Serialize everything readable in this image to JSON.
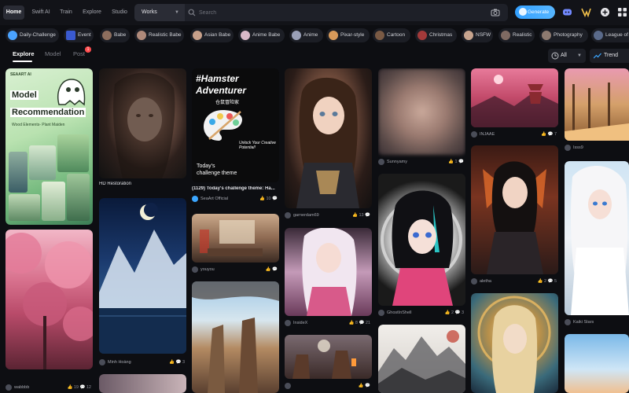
{
  "nav": {
    "tabs": [
      "Home",
      "Swift AI",
      "Train",
      "Explore",
      "Studio"
    ],
    "active_tab": "Home"
  },
  "search": {
    "scope": "Works",
    "placeholder": "Search"
  },
  "header": {
    "generate_label": "Generate",
    "icons": [
      "discord-icon",
      "vip-icon",
      "add-icon",
      "apps-grid-icon"
    ]
  },
  "categories": [
    "Daily-Challenge",
    "Event",
    "Babe",
    "Realistic Babe",
    "Asian Babe",
    "Anime Babe",
    "Anime",
    "Pixar-style",
    "Cartoon",
    "Christmas",
    "NSFW",
    "Realistic",
    "Photography",
    "League of"
  ],
  "subtabs": {
    "items": [
      "Explore",
      "Model",
      "Post"
    ],
    "active": "Explore",
    "post_badge": "1"
  },
  "filters": {
    "all_label": "All",
    "trend_label": "Trend"
  },
  "cards": {
    "c1": {
      "overlay_brand": "SEAART AI",
      "overlay_title_1": "Model",
      "overlay_title_2": "Recommendation",
      "overlay_subtitle": "Wood Elements- Plant Maiden",
      "author": "",
      "likes": "",
      "comments": ""
    },
    "c2": {
      "title": "HD Restoration"
    },
    "c3": {
      "overlay_title_1": "#Hamster",
      "overlay_title_2": "Adventurer",
      "overlay_sub": "仓鼠冒险家",
      "overlay_tagline": "Unlock Your Creative Potential!",
      "overlay_theme_1": "Today's",
      "overlay_theme_2": "challenge theme",
      "title": "(1129) Today's challenge theme: Ha...",
      "author": "SeaArt Official",
      "likes": "10",
      "comments": ""
    },
    "c4": {
      "author": "garnerdam69",
      "likes": "13",
      "comments": ""
    },
    "c5": {
      "author": "Sunnyamy",
      "likes": "1",
      "comments": ""
    },
    "c6": {
      "author": "INJAAE",
      "likes": "",
      "comments": "7"
    },
    "c7": {
      "author": "Isss9",
      "likes": "",
      "comments": ""
    },
    "c8": {
      "author": "Minh Hoàng",
      "likes": "",
      "comments": "3"
    },
    "c9": {
      "author": "youyou",
      "likes": "",
      "comments": ""
    },
    "c10": {
      "author": "InsideX",
      "likes": "8",
      "comments": "21"
    },
    "c11": {
      "author": "GhostInShell",
      "likes": "2",
      "comments": "3"
    },
    "c12": {
      "author": "aletha",
      "likes": "2",
      "comments": "5"
    },
    "c13": {
      "author": "Kaiki Stars",
      "likes": "",
      "comments": ""
    },
    "c14": {
      "author": "wabbbb",
      "likes": "19",
      "comments": "12"
    },
    "c15": {
      "author": "",
      "likes": "10",
      "comments": ""
    },
    "c16": {
      "author": "",
      "likes": "",
      "comments": ""
    }
  },
  "colors": {
    "background": "#0d0e12",
    "accent": "#3ba6ff",
    "badge": "#ff4d4f"
  }
}
